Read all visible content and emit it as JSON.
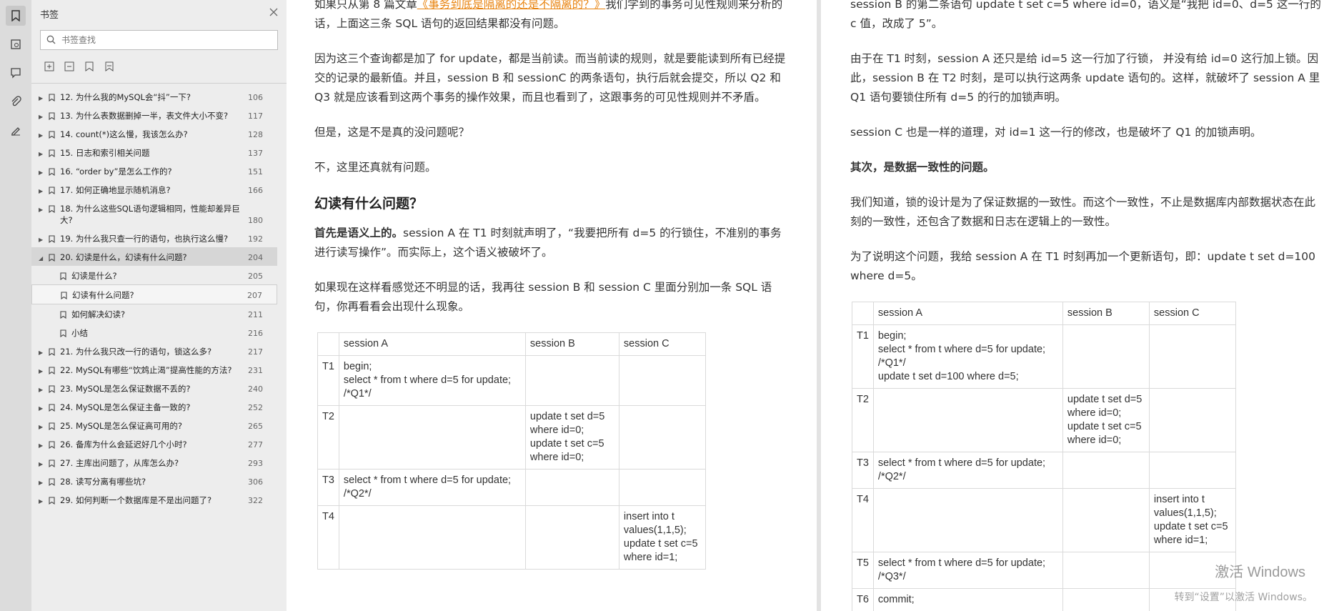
{
  "sidebar": {
    "title": "书签",
    "search_placeholder": "书签查找",
    "items": [
      {
        "label": "12. 为什么我的MySQL会“抖”一下?",
        "page": "106"
      },
      {
        "label": "13. 为什么表数据删掉一半，表文件大小不变?",
        "page": "117"
      },
      {
        "label": "14. count(*)这么慢，我该怎么办?",
        "page": "128"
      },
      {
        "label": "15. 日志和索引相关问题",
        "page": "137"
      },
      {
        "label": "16. “order by”是怎么工作的?",
        "page": "151"
      },
      {
        "label": "17. 如何正确地显示随机消息?",
        "page": "166"
      },
      {
        "label": "18. 为什么这些SQL语句逻辑相同，性能却差异巨大?",
        "page": "180"
      },
      {
        "label": "19. 为什么我只查一行的语句，也执行这么慢?",
        "page": "192"
      },
      {
        "label": "20. 幻读是什么，幻读有什么问题?",
        "page": "204"
      },
      {
        "label": "幻读是什么?",
        "page": "205"
      },
      {
        "label": "幻读有什么问题?",
        "page": "207"
      },
      {
        "label": "如何解决幻读?",
        "page": "211"
      },
      {
        "label": "小结",
        "page": "216"
      },
      {
        "label": "21. 为什么我只改一行的语句，锁这么多?",
        "page": "217"
      },
      {
        "label": "22. MySQL有哪些“饮鸩止渴”提高性能的方法?",
        "page": "231"
      },
      {
        "label": "23. MySQL是怎么保证数据不丢的?",
        "page": "240"
      },
      {
        "label": "24. MySQL是怎么保证主备一致的?",
        "page": "252"
      },
      {
        "label": "25. MySQL是怎么保证高可用的?",
        "page": "265"
      },
      {
        "label": "26. 备库为什么会延迟好几个小时?",
        "page": "277"
      },
      {
        "label": "27. 主库出问题了，从库怎么办?",
        "page": "293"
      },
      {
        "label": "28. 读写分离有哪些坑?",
        "page": "306"
      },
      {
        "label": "29. 如何判断一个数据库是不是出问题了?",
        "page": "322"
      }
    ]
  },
  "left_page": {
    "p1a": "如果只从第 8 篇文章",
    "p1link": "《事务到底是隔离的还是不隔离的？》",
    "p1b": "我们学到的事务可见性规则来分析的话，上面这三条 SQL 语句的返回结果都没有问题。",
    "p2": "因为这三个查询都是加了 for update，都是当前读。而当前读的规则，就是要能读到所有已经提交的记录的最新值。并且，session B 和 sessionC 的两条语句，执行后就会提交，所以 Q2 和 Q3 就是应该看到这两个事务的操作效果，而且也看到了，这跟事务的可见性规则并不矛盾。",
    "p3": "但是，这是不是真的没问题呢？",
    "p4": "不，这里还真就有问题。",
    "h": "幻读有什么问题？",
    "p5bold": "首先是语义上的。",
    "p5": "session A 在 T1 时刻就声明了，“我要把所有 d=5 的行锁住，不准别的事务进行读写操作”。而实际上，这个语义被破坏了。",
    "p6": "如果现在这样看感觉还不明显的话，我再往 session B 和 session C 里面分别加一条 SQL 语句，你再看看会出现什么现象。",
    "table": {
      "headers": [
        "",
        "session A",
        "session B",
        "session C"
      ],
      "rows": [
        [
          "T1",
          "begin;\nselect * from t where d=5 for update; /*Q1*/",
          "",
          ""
        ],
        [
          "T2",
          "",
          "update t set d=5\nwhere id=0;\nupdate t set c=5\nwhere id=0;",
          ""
        ],
        [
          "T3",
          "select * from t where d=5 for update; /*Q2*/",
          "",
          ""
        ],
        [
          "T4",
          "",
          "",
          "insert into t\nvalues(1,1,5);\nupdate t set c=5\nwhere id=1;"
        ]
      ]
    }
  },
  "right_page": {
    "p1": "session B 的第二条语句 update t set c=5 where id=0，语义是“我把 id=0、d=5 这一行的 c 值，改成了 5”。",
    "p2": "由于在 T1 时刻，session A 还只是给 id=5 这一行加了行锁， 并没有给 id=0 这行加上锁。因此，session B 在 T2 时刻，是可以执行这两条 update 语句的。这样，就破坏了 session A 里 Q1 语句要锁住所有 d=5 的行的加锁声明。",
    "p3": "session C 也是一样的道理，对 id=1 这一行的修改，也是破坏了 Q1 的加锁声明。",
    "p4": "其次，是数据一致性的问题。",
    "p5": "我们知道，锁的设计是为了保证数据的一致性。而这个一致性，不止是数据库内部数据状态在此刻的一致性，还包含了数据和日志在逻辑上的一致性。",
    "p6": "为了说明这个问题，我给 session A 在 T1 时刻再加一个更新语句，即：update t set d=100 where d=5。",
    "table": {
      "headers": [
        "",
        "session A",
        "session B",
        "session C"
      ],
      "rows": [
        [
          "T1",
          "begin;\nselect * from t where d=5 for update; /*Q1*/\nupdate t set d=100 where d=5;",
          "",
          ""
        ],
        [
          "T2",
          "",
          "update t set d=5\nwhere id=0;\nupdate t set c=5\nwhere id=0;",
          ""
        ],
        [
          "T3",
          "select * from t where d=5 for update; /*Q2*/",
          "",
          ""
        ],
        [
          "T4",
          "",
          "",
          "insert into t\nvalues(1,1,5);\nupdate t set c=5\nwhere id=1;"
        ],
        [
          "T5",
          "select * from t where d=5 for update; /*Q3*/",
          "",
          ""
        ],
        [
          "T6",
          "commit;",
          "",
          ""
        ]
      ]
    }
  },
  "watermark": {
    "line1": "激活 Windows",
    "line2": "转到“设置”以激活 Windows。"
  }
}
